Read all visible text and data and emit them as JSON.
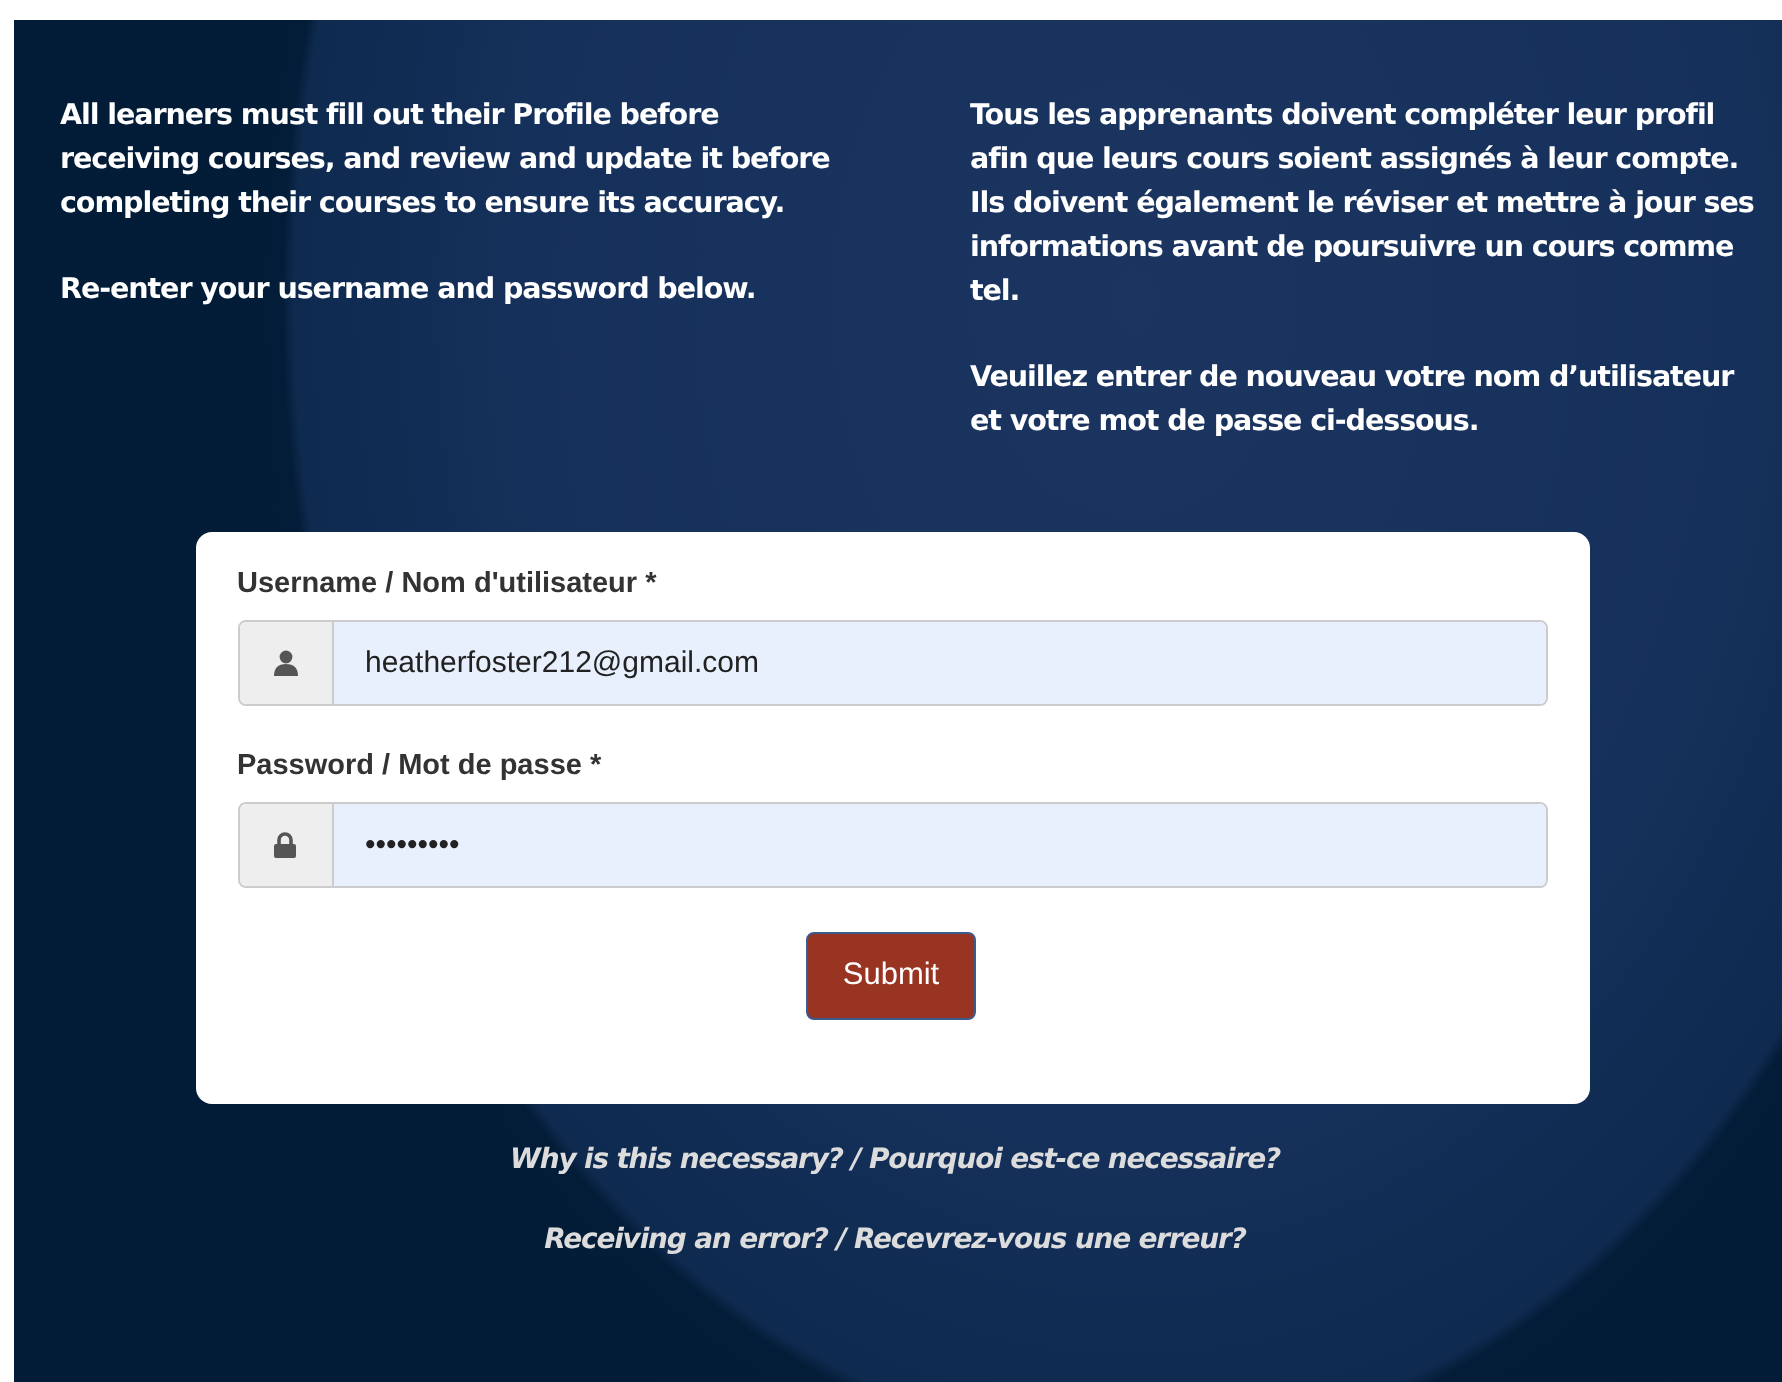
{
  "intro_en": [
    "All learners must fill out their Profile before receiving courses, and review and update it before completing their courses to ensure its accuracy.",
    "Re-enter your username and password below."
  ],
  "intro_fr": [
    "Tous les apprenants doivent compléter leur profil afin que leurs cours soient assignés à leur compte. Ils doivent également le réviser et mettre à jour ses informations avant de poursuivre un cours comme tel.",
    "Veuillez entrer de nouveau votre nom d’utilisateur et votre mot de passe ci-dessous."
  ],
  "form": {
    "fields": [
      {
        "kind": "username",
        "label": "Username / Nom d'utilisateur *",
        "value": "heatherfoster212@gmail.com"
      },
      {
        "kind": "password",
        "label": "Password / Mot de passe *",
        "value": "•••••••••"
      }
    ],
    "submit": "Submit"
  },
  "links": [
    "Why is this necessary? / Pourquoi est-ce necessaire?",
    "Receiving an error? / Recevrez-vous une erreur?"
  ]
}
